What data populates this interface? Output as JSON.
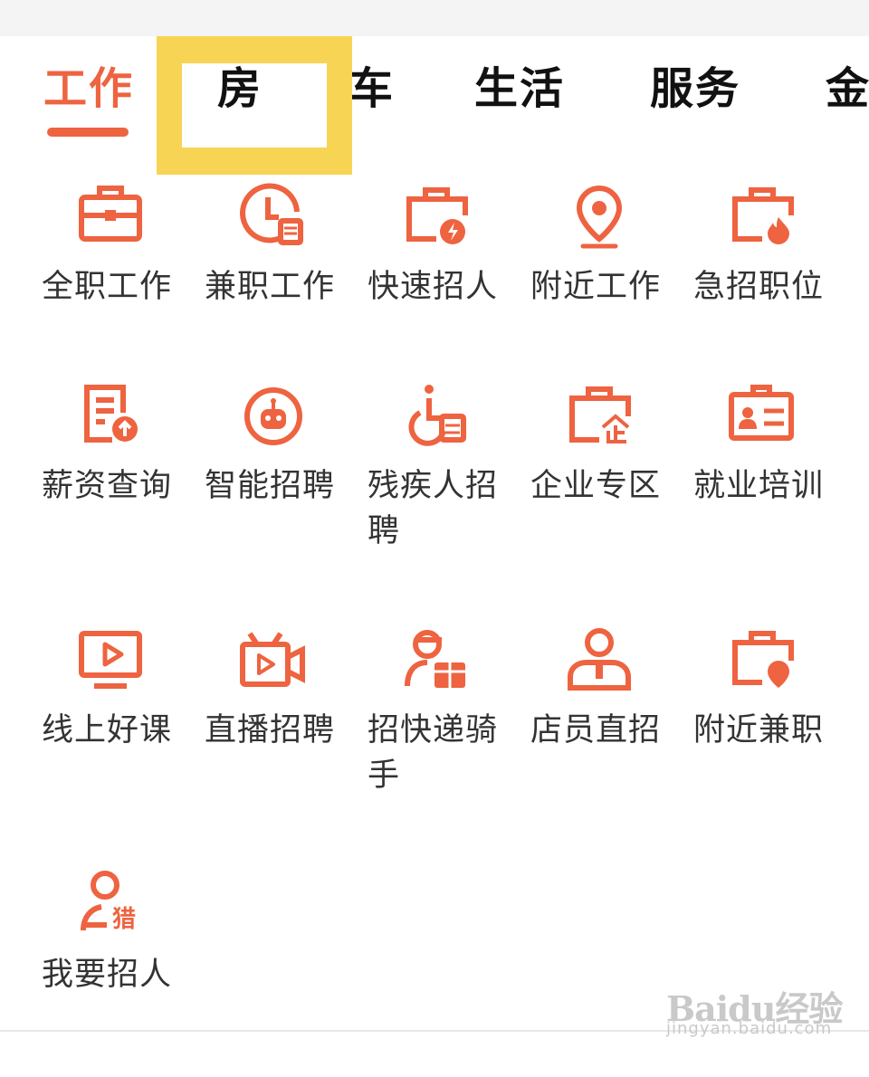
{
  "tabs": [
    {
      "label": "工作",
      "active": true
    },
    {
      "label": "房",
      "active": false
    },
    {
      "label": "车",
      "active": false
    },
    {
      "label": "生活",
      "active": false
    },
    {
      "label": "服务",
      "active": false
    },
    {
      "label": "金",
      "active": false
    }
  ],
  "items": [
    {
      "label": "全职工作",
      "icon": "briefcase-icon"
    },
    {
      "label": "兼职工作",
      "icon": "clock-doc-icon"
    },
    {
      "label": "快速招人",
      "icon": "briefcase-lightning-icon"
    },
    {
      "label": "附近工作",
      "icon": "location-pin-icon"
    },
    {
      "label": "急招职位",
      "icon": "briefcase-fire-icon"
    },
    {
      "label": "薪资查询",
      "icon": "salary-doc-icon"
    },
    {
      "label": "智能招聘",
      "icon": "robot-icon"
    },
    {
      "label": "残疾人招聘",
      "icon": "wheelchair-icon"
    },
    {
      "label": "企业专区",
      "icon": "enterprise-briefcase-icon"
    },
    {
      "label": "就业培训",
      "icon": "id-card-icon"
    },
    {
      "label": "线上好课",
      "icon": "video-screen-icon"
    },
    {
      "label": "直播招聘",
      "icon": "live-camera-icon"
    },
    {
      "label": "招快递骑手",
      "icon": "courier-icon"
    },
    {
      "label": "店员直招",
      "icon": "clerk-icon"
    },
    {
      "label": "附近兼职",
      "icon": "briefcase-location-icon"
    },
    {
      "label": "我要招人",
      "icon": "headhunter-icon"
    }
  ],
  "colors": {
    "accent": "#ee6340",
    "highlight": "#f8d455"
  },
  "watermark": {
    "brand": "Baidu经验",
    "url": "jingyan.baidu.com"
  }
}
